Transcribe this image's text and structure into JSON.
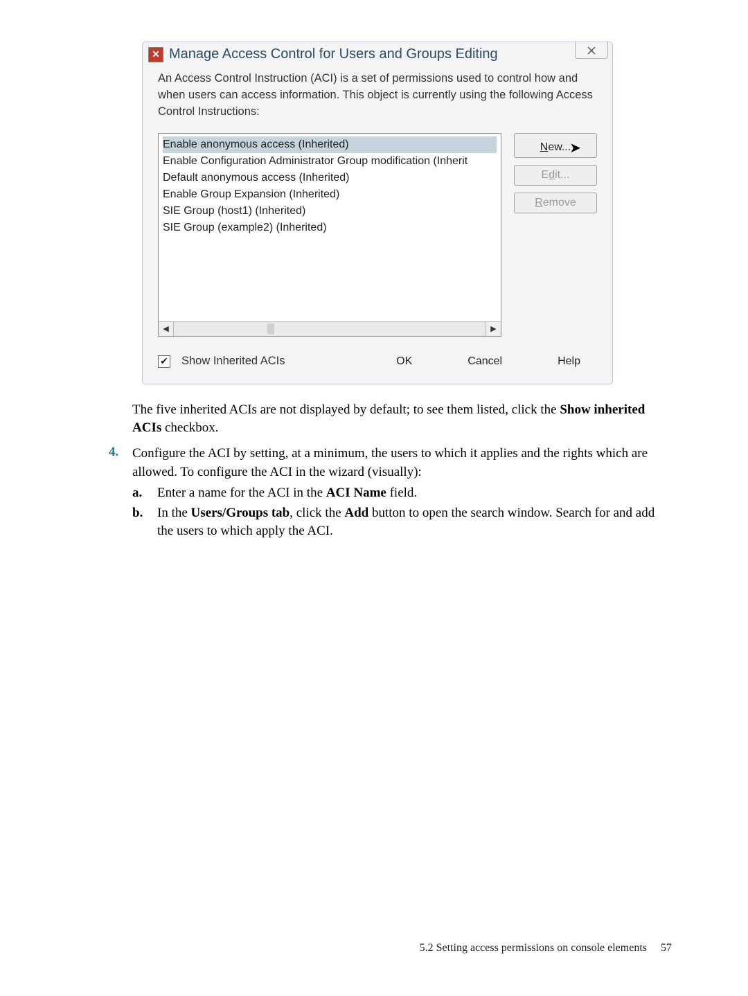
{
  "dialog": {
    "title": "Manage Access Control for Users and Groups Editing",
    "description": "An Access Control Instruction (ACI) is a set of permissions used to control how and when users can access information. This object is currently using the following Access Control Instructions:",
    "list_items": [
      "Enable anonymous access (Inherited)",
      "Enable Configuration Administrator Group modification (Inherit",
      "Default anonymous access (Inherited)",
      "Enable Group Expansion (Inherited)",
      "SIE Group (host1) (Inherited)",
      "SIE Group (example2) (Inherited)"
    ],
    "buttons": {
      "new": "New...",
      "edit": "Edit...",
      "remove": "Remove"
    },
    "checkbox_label": "Show Inherited ACIs",
    "bottom_buttons": {
      "ok": "OK",
      "cancel": "Cancel",
      "help": "Help"
    }
  },
  "doc": {
    "para1_a": "The five inherited ACIs are not displayed by default; to see them listed, click the ",
    "para1_b": "Show inherited ACIs",
    "para1_c": " checkbox.",
    "step4_num": "4.",
    "step4_text": "Configure the ACI by setting, at a minimum, the users to which it applies and the rights which are allowed. To configure the ACI in the wizard (visually):",
    "sub_a_letter": "a.",
    "sub_a_1": "Enter a name for the ACI in the ",
    "sub_a_2": "ACI Name",
    "sub_a_3": " field.",
    "sub_b_letter": "b.",
    "sub_b_1": "In the ",
    "sub_b_2": "Users/Groups tab",
    "sub_b_3": ", click the ",
    "sub_b_4": "Add",
    "sub_b_5": " button to open the search window. Search for and add the users to which apply the ACI.",
    "footer_section": "5.2 Setting access permissions on console elements",
    "footer_page": "57"
  }
}
